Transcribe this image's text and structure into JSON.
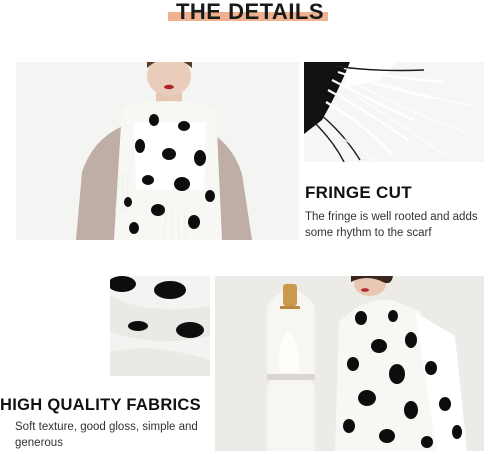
{
  "page": {
    "title": "THE DETAILS"
  },
  "sections": [
    {
      "heading": "FRINGE CUT",
      "description": "The fringe is well rooted and adds some rhythm to the scarf"
    },
    {
      "heading": "HIGH QUALITY FABRICS",
      "description": "Soft texture, good gloss, simple and generous"
    }
  ],
  "colors": {
    "title_highlight": "#efb18f",
    "scarf_white": "#f7f7f4",
    "spot_black": "#0d0d0d",
    "coat_taupe": "#bfaea6",
    "arch_wall": "#ecebe7",
    "vase_gold": "#c99a4a"
  }
}
